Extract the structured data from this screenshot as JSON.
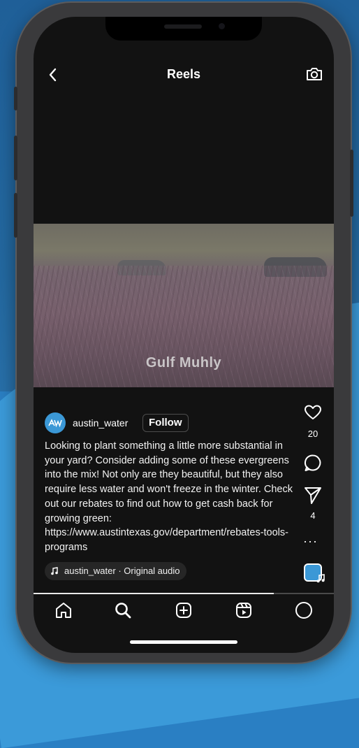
{
  "header": {
    "title": "Reels"
  },
  "video": {
    "overlay_text": "Gulf Muhly"
  },
  "post": {
    "username": "austin_water",
    "follow_label": "Follow",
    "caption": "Looking to plant something a little more substantial in your yard? Consider adding some of these evergreens into the mix! Not only are they beautiful, but they also require less water and won't freeze in the winter. Check out our rebates to find out how to get cash back for growing green:  https://www.austintexas.gov/department/rebates-tools-programs",
    "audio_label": "austin_water · Original audio"
  },
  "actions": {
    "likes": "20",
    "shares": "4"
  },
  "playback": {
    "progress_fraction": 0.8
  },
  "icons": {
    "back": "chevron-left-icon",
    "camera": "camera-icon",
    "like": "heart-icon",
    "comment": "comment-icon",
    "share": "paper-plane-icon",
    "more": "ellipsis-icon",
    "nav": [
      "home-icon",
      "search-icon",
      "create-icon",
      "reels-icon",
      "profile-icon"
    ]
  },
  "colors": {
    "brand_blue": "#3b98d6",
    "screen_background": "#121212"
  }
}
